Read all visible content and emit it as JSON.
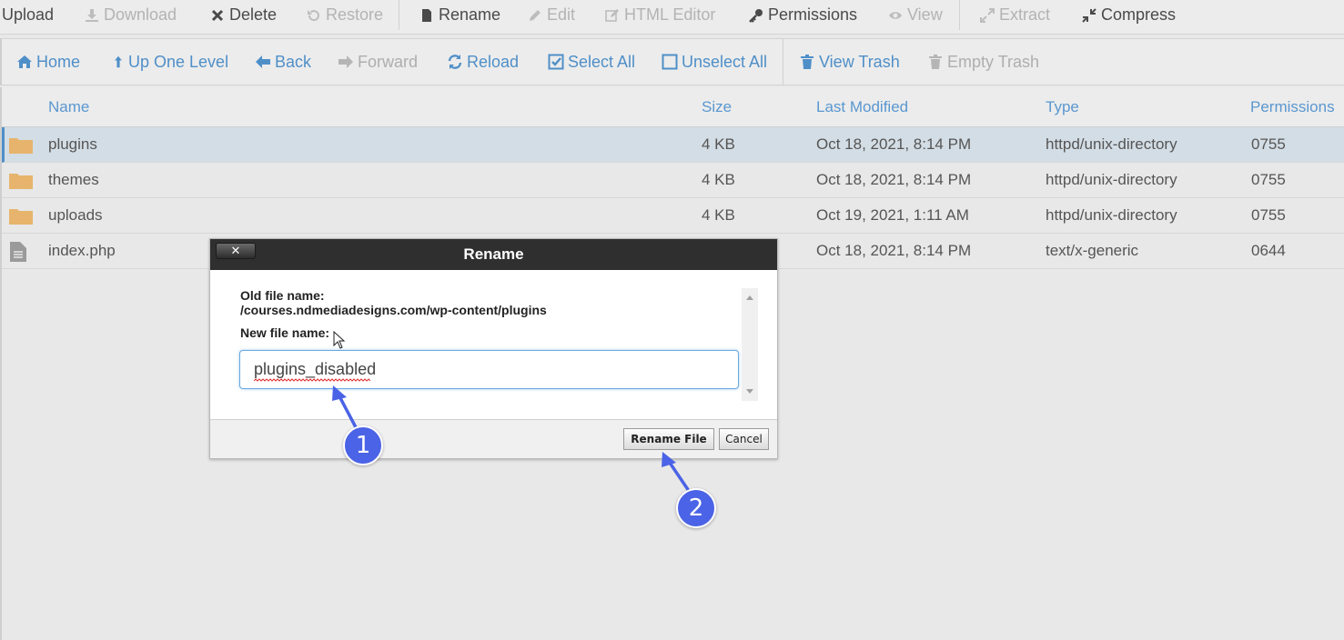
{
  "toolbar_top": {
    "items": [
      {
        "label": "Upload",
        "icon": "upload-icon",
        "enabled": true
      },
      {
        "label": "Download",
        "icon": "download-icon",
        "enabled": false
      },
      {
        "label": "Delete",
        "icon": "delete-icon",
        "enabled": true
      },
      {
        "label": "Restore",
        "icon": "restore-icon",
        "enabled": false
      },
      {
        "label": "Rename",
        "icon": "file-icon",
        "enabled": true
      },
      {
        "label": "Edit",
        "icon": "pencil-icon",
        "enabled": false
      },
      {
        "label": "HTML Editor",
        "icon": "edit-icon",
        "enabled": false
      },
      {
        "label": "Permissions",
        "icon": "key-icon",
        "enabled": true
      },
      {
        "label": "View",
        "icon": "eye-icon",
        "enabled": false
      },
      {
        "label": "Extract",
        "icon": "expand-icon",
        "enabled": false
      },
      {
        "label": "Compress",
        "icon": "compress-icon",
        "enabled": true
      }
    ]
  },
  "toolbar_nav": {
    "items": [
      {
        "label": "Home",
        "icon": "home-icon",
        "enabled": true
      },
      {
        "label": "Up One Level",
        "icon": "up-arrow-icon",
        "enabled": true
      },
      {
        "label": "Back",
        "icon": "left-arrow-icon",
        "enabled": true
      },
      {
        "label": "Forward",
        "icon": "right-arrow-icon",
        "enabled": false
      },
      {
        "label": "Reload",
        "icon": "reload-icon",
        "enabled": true
      },
      {
        "label": "Select All",
        "icon": "checkbox-checked-icon",
        "enabled": true
      },
      {
        "label": "Unselect All",
        "icon": "checkbox-empty-icon",
        "enabled": true
      },
      {
        "label": "View Trash",
        "icon": "trash-icon",
        "enabled": true
      },
      {
        "label": "Empty Trash",
        "icon": "trash-icon",
        "enabled": false
      }
    ]
  },
  "table": {
    "columns": [
      "Name",
      "Size",
      "Last Modified",
      "Type",
      "Permissions"
    ],
    "rows": [
      {
        "name": "plugins",
        "size": "4 KB",
        "modified": "Oct 18, 2021, 8:14 PM",
        "type": "httpd/unix-directory",
        "perms": "0755",
        "kind": "folder",
        "selected": true
      },
      {
        "name": "themes",
        "size": "4 KB",
        "modified": "Oct 18, 2021, 8:14 PM",
        "type": "httpd/unix-directory",
        "perms": "0755",
        "kind": "folder",
        "selected": false
      },
      {
        "name": "uploads",
        "size": "4 KB",
        "modified": "Oct 19, 2021, 1:11 AM",
        "type": "httpd/unix-directory",
        "perms": "0755",
        "kind": "folder",
        "selected": false
      },
      {
        "name": "index.php",
        "size": "",
        "modified": "Oct 18, 2021, 8:14 PM",
        "type": "text/x-generic",
        "perms": "0644",
        "kind": "file",
        "selected": false
      }
    ]
  },
  "dialog": {
    "title": "Rename",
    "close_glyph": "✕",
    "old_label": "Old file name:",
    "old_path": "/courses.ndmediadesigns.com/wp-content/plugins",
    "new_label": "New file name:",
    "new_value": "plugins_disabled",
    "rename_button": "Rename File",
    "cancel_button": "Cancel"
  },
  "annotations": {
    "step1": "1",
    "step2": "2",
    "color": "#4b63e6"
  },
  "colors": {
    "accent": "#4f8fc8",
    "folder": "#e6b46c",
    "selected_row": "#d3dde5"
  }
}
